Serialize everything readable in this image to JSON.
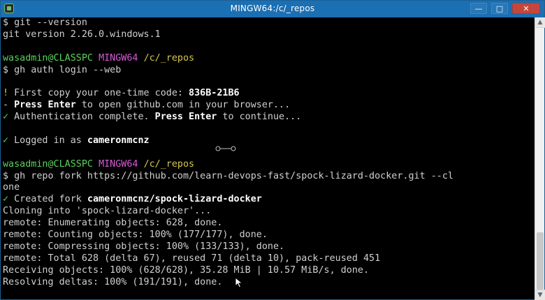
{
  "window": {
    "title": "MINGW64:/c/_repos",
    "controls": {
      "minimize": "—",
      "maximize": "□",
      "close": "✕"
    }
  },
  "terminal": {
    "lines": [
      {
        "segments": [
          {
            "text": "$ git --version",
            "style": "white"
          }
        ]
      },
      {
        "segments": [
          {
            "text": "git version 2.26.0.windows.1",
            "style": "white"
          }
        ]
      },
      {
        "segments": [
          {
            "text": "",
            "style": "white"
          }
        ]
      },
      {
        "segments": [
          {
            "text": "wasadmin@CLASSPC",
            "style": "green"
          },
          {
            "text": " ",
            "style": "white"
          },
          {
            "text": "MINGW64",
            "style": "magenta"
          },
          {
            "text": " ",
            "style": "white"
          },
          {
            "text": "/c/_repos",
            "style": "yellow"
          }
        ]
      },
      {
        "segments": [
          {
            "text": "$ gh auth login --web",
            "style": "white"
          }
        ]
      },
      {
        "segments": [
          {
            "text": "",
            "style": "white"
          }
        ]
      },
      {
        "segments": [
          {
            "text": "! ",
            "style": "yellow"
          },
          {
            "text": "First copy your one-time code: ",
            "style": "white"
          },
          {
            "text": "836B-21B6",
            "style": "bright"
          }
        ]
      },
      {
        "segments": [
          {
            "text": "- ",
            "style": "white"
          },
          {
            "text": "Press Enter",
            "style": "bright"
          },
          {
            "text": " to open github.com in your browser...",
            "style": "white"
          }
        ]
      },
      {
        "segments": [
          {
            "text": "✓ ",
            "style": "green"
          },
          {
            "text": "Authentication complete. ",
            "style": "white"
          },
          {
            "text": "Press Enter",
            "style": "bright"
          },
          {
            "text": " to continue...",
            "style": "white"
          }
        ]
      },
      {
        "segments": [
          {
            "text": "",
            "style": "white"
          }
        ]
      },
      {
        "segments": [
          {
            "text": "✓ ",
            "style": "green"
          },
          {
            "text": "Logged in as ",
            "style": "white"
          },
          {
            "text": "cameronmcnz",
            "style": "bright"
          }
        ]
      },
      {
        "segments": [
          {
            "text": "",
            "style": "white"
          }
        ]
      },
      {
        "segments": [
          {
            "text": "wasadmin@CLASSPC",
            "style": "green"
          },
          {
            "text": " ",
            "style": "white"
          },
          {
            "text": "MINGW64",
            "style": "magenta"
          },
          {
            "text": " ",
            "style": "white"
          },
          {
            "text": "/c/_repos",
            "style": "yellow"
          }
        ]
      },
      {
        "segments": [
          {
            "text": "$ gh repo fork https://github.com/learn-devops-fast/spock-lizard-docker.git --cl",
            "style": "white"
          }
        ]
      },
      {
        "segments": [
          {
            "text": "one",
            "style": "white"
          }
        ]
      },
      {
        "segments": [
          {
            "text": "✓ ",
            "style": "green"
          },
          {
            "text": "Created fork ",
            "style": "white"
          },
          {
            "text": "cameronmcnz/spock-lizard-docker",
            "style": "bright"
          }
        ]
      },
      {
        "segments": [
          {
            "text": "Cloning into 'spock-lizard-docker'...",
            "style": "white"
          }
        ]
      },
      {
        "segments": [
          {
            "text": "remote: Enumerating objects: 628, done.",
            "style": "white"
          }
        ]
      },
      {
        "segments": [
          {
            "text": "remote: Counting objects: 100% (177/177), done.",
            "style": "white"
          }
        ]
      },
      {
        "segments": [
          {
            "text": "remote: Compressing objects: 100% (133/133), done.",
            "style": "white"
          }
        ]
      },
      {
        "segments": [
          {
            "text": "remote: Total 628 (delta 67), reused 71 (delta 10), pack-reused 451",
            "style": "white"
          }
        ]
      },
      {
        "segments": [
          {
            "text": "Receiving objects: 100% (628/628), 35.28 MiB | 10.57 MiB/s, done.",
            "style": "white"
          }
        ]
      },
      {
        "segments": [
          {
            "text": "Resolving deltas: 100% (191/191), done.",
            "style": "white"
          }
        ]
      }
    ]
  },
  "colors": {
    "titlebar": "#1b6fb3",
    "background": "#000000",
    "text": "#d0d0d0",
    "prompt_user": "#59d359",
    "prompt_env": "#d75ad7",
    "prompt_path": "#d7c84a",
    "close_button": "#c7463b"
  }
}
